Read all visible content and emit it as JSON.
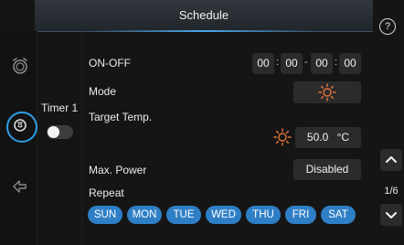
{
  "header": {
    "title": "Schedule",
    "help_label": "?"
  },
  "sidebar": {
    "items": [
      {
        "name": "alarm-clock-icon",
        "active": false
      },
      {
        "name": "timer-icon",
        "active": true
      },
      {
        "name": "back-icon",
        "active": false
      }
    ]
  },
  "timer": {
    "label": "Timer 1",
    "enabled": false
  },
  "rows": {
    "on_off": {
      "label": "ON-OFF",
      "on_hour": "00",
      "on_minute": "00",
      "off_hour": "00",
      "off_minute": "00",
      "time_sep": ":",
      "range_sep": "-"
    },
    "mode": {
      "label": "Mode",
      "value_icon": "sun-icon"
    },
    "target_temp": {
      "label": "Target Temp.",
      "value": "50.0",
      "unit": "°C"
    },
    "max_power": {
      "label": "Max. Power",
      "value": "Disabled"
    },
    "repeat": {
      "label": "Repeat",
      "days": [
        "SUN",
        "MON",
        "TUE",
        "WED",
        "THU",
        "FRI",
        "SAT"
      ]
    }
  },
  "pagination": {
    "indicator": "1/6"
  },
  "colors": {
    "accent": "#2e9fe6",
    "day_pill": "#2f7fc6",
    "sun_icon": "#e8743a"
  }
}
